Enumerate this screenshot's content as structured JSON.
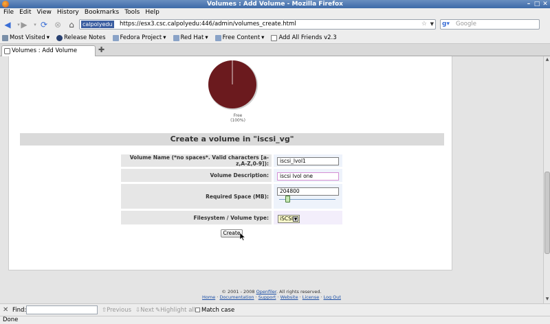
{
  "window": {
    "title": "Volumes : Add Volume - Mozilla Firefox"
  },
  "menu": [
    "File",
    "Edit",
    "View",
    "History",
    "Bookmarks",
    "Tools",
    "Help"
  ],
  "nav": {
    "site_identity": "calpolyedu",
    "url": "https://esx3.csc.calpolyedu:446/admin/volumes_create.html",
    "search_placeholder": "Google"
  },
  "bookmarks": [
    {
      "label": "Most Visited",
      "icon": "gear-icon",
      "dropdown": true
    },
    {
      "label": "Release Notes",
      "icon": "fedora-icon",
      "dropdown": false
    },
    {
      "label": "Fedora Project",
      "icon": "folder-icon",
      "dropdown": true
    },
    {
      "label": "Red Hat",
      "icon": "folder-icon",
      "dropdown": true
    },
    {
      "label": "Free Content",
      "icon": "folder-icon",
      "dropdown": true
    },
    {
      "label": "Add All Friends v2.3",
      "icon": "page-icon",
      "dropdown": false
    }
  ],
  "tab": {
    "label": "Volumes : Add Volume"
  },
  "chart_data": {
    "type": "pie",
    "slices": [
      {
        "label": "Free",
        "percent": 100
      }
    ],
    "annotations": [
      "Free",
      "(100%)"
    ],
    "color": "#6b1a1e"
  },
  "form": {
    "title": "Create a volume in \"iscsi_vg\"",
    "volume_name_label": "Volume Name (*no spaces*. Valid characters [a-z,A-Z,0-9]):",
    "volume_name_value": "iscsi_lvol1",
    "description_label": "Volume Description:",
    "description_value": "iscsi lvol one",
    "space_label": "Required Space (MB):",
    "space_value": "204800",
    "space_slider_fraction": 0.15,
    "fs_label": "Filesystem / Volume type:",
    "fs_value": "iSCSI",
    "create_label": "Create"
  },
  "footer": {
    "copyright": "© 2001 - 2008 ",
    "brand_link": "Openfiler",
    "rights": ". All rights reserved.",
    "links": [
      "Home",
      "Documentation",
      "Support",
      "Website",
      "License",
      "Log Out"
    ]
  },
  "find": {
    "label": "Find:",
    "previous": "Previous",
    "next": "Next",
    "highlight": "Highlight all",
    "match_case": "Match case"
  },
  "status": {
    "text": "Done"
  }
}
